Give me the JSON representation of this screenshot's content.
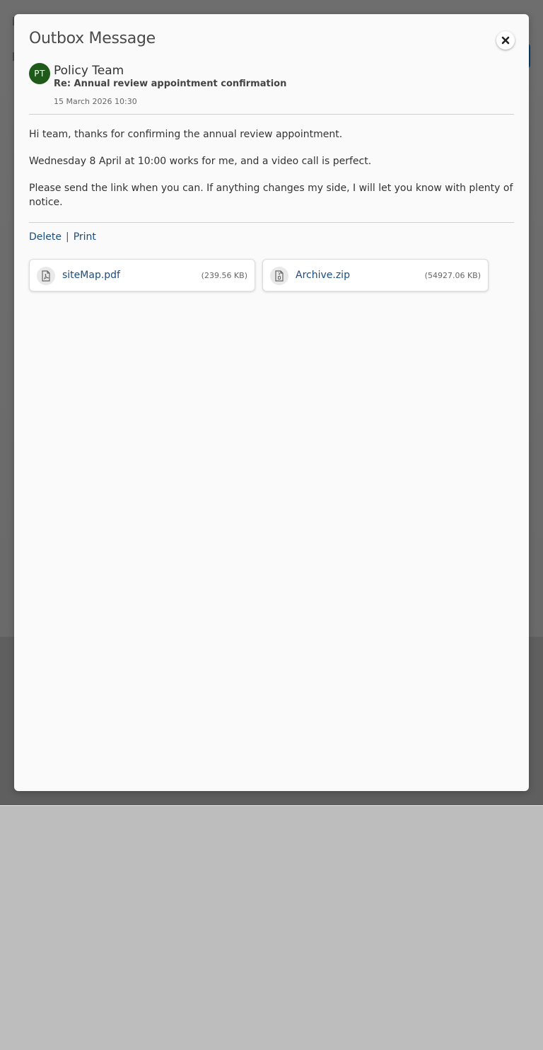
{
  "modal": {
    "title": "Outbox Message",
    "close_icon": "close-icon"
  },
  "message": {
    "avatar_initials": "PT",
    "avatar_color": "#1e5a1a",
    "sender": "Policy Team",
    "subject": "Re: Annual review appointment confirmation",
    "timestamp": "15 March 2026 10:30",
    "body": [
      "Hi team, thanks for confirming the annual review appointment.",
      "Wednesday 8 April at 10:00 works for me, and a video call is perfect.",
      "Please send the link when you can. If anything changes my side, I will let you know with plenty of notice."
    ]
  },
  "actions": {
    "delete_label": "Delete",
    "separator": "|",
    "print_label": "Print"
  },
  "attachments": [
    {
      "name": "siteMap.pdf",
      "size": "(239.56 KB)",
      "icon": "pdf-file-icon"
    },
    {
      "name": "Archive.zip",
      "size": "(54927.06 KB)",
      "icon": "zip-file-icon"
    }
  ],
  "colors": {
    "link": "#1a4d80",
    "overlay": "#6e6e6e"
  }
}
